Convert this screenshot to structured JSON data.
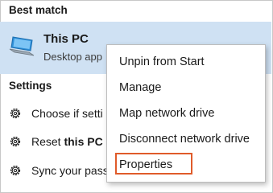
{
  "start_menu": {
    "best_match_heading": "Best match",
    "best_match": {
      "title": "This PC",
      "subtitle": "Desktop app",
      "icon": "computer-icon"
    },
    "settings_heading": "Settings",
    "settings": [
      {
        "label": "Choose if setti",
        "icon": "gear-icon"
      },
      {
        "label_prefix": "Reset ",
        "label_bold": "this PC",
        "icon": "gear-icon"
      },
      {
        "label": "Sync your pass",
        "icon": "gear-icon"
      }
    ]
  },
  "context_menu": {
    "items": [
      {
        "label": "Unpin from Start"
      },
      {
        "label": "Manage"
      },
      {
        "label": "Map network drive"
      },
      {
        "label": "Disconnect network drive"
      },
      {
        "label": "Properties",
        "highlighted": true
      }
    ],
    "highlight_color": "#e05b2a"
  },
  "colors": {
    "selection_background": "#cfe1f3"
  }
}
